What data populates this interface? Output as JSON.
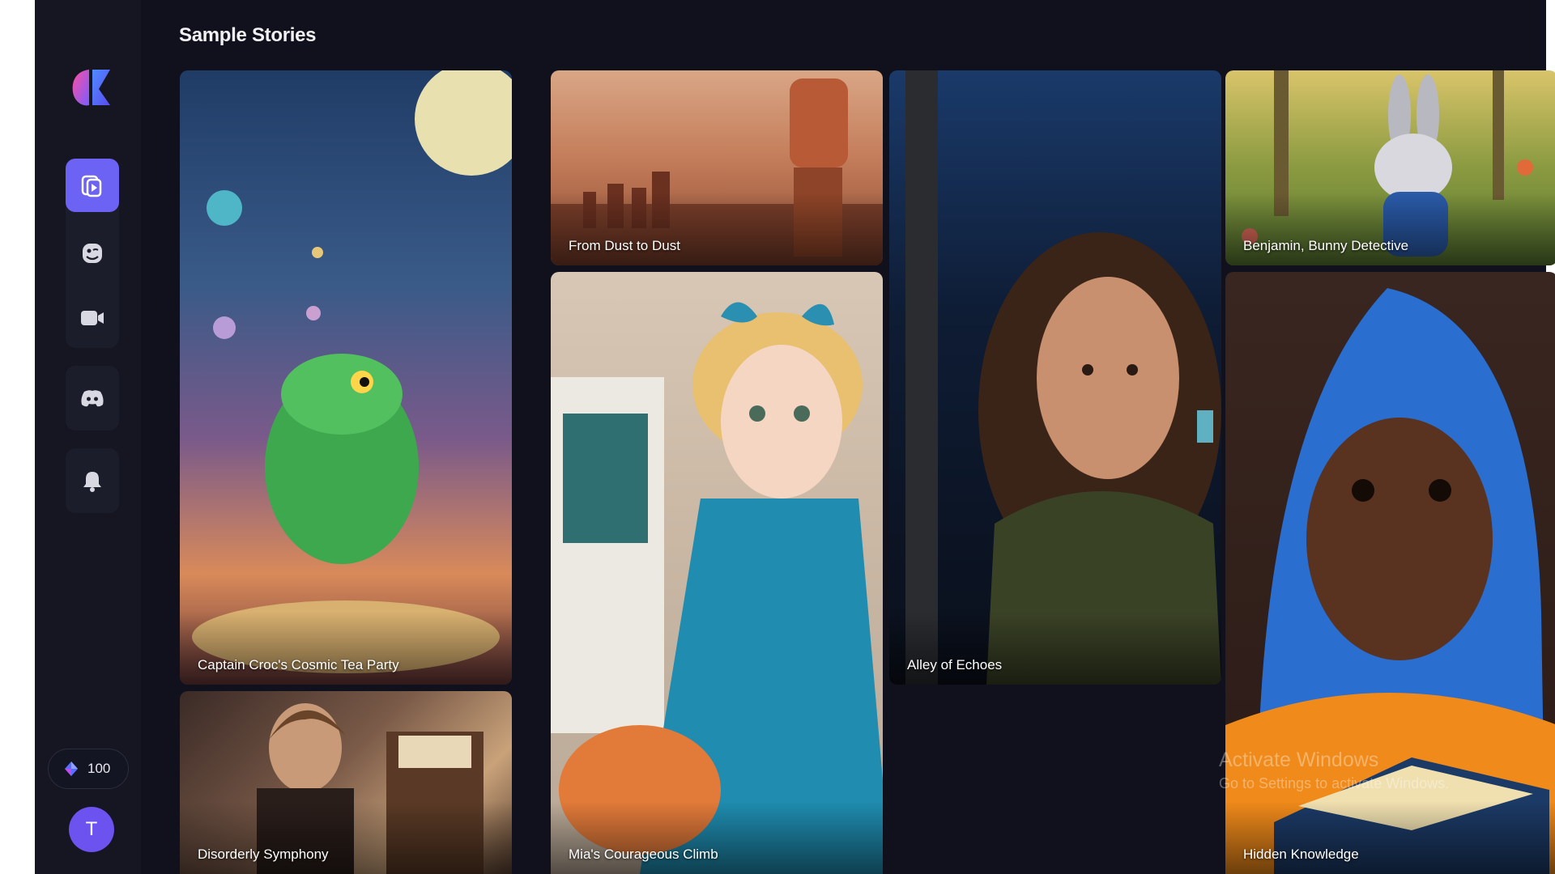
{
  "page": {
    "title": "Sample Stories"
  },
  "sidebar": {
    "nav": [
      {
        "icon": "stories-icon",
        "active": true
      },
      {
        "icon": "character-icon",
        "active": false
      },
      {
        "icon": "video-icon",
        "active": false
      }
    ],
    "discord_icon": "discord-icon",
    "notifications_icon": "bell-icon",
    "credits": {
      "icon": "diamond-icon",
      "value": "100"
    },
    "avatar_initial": "T"
  },
  "stories": [
    {
      "title": "Captain Croc's Cosmic Tea Party"
    },
    {
      "title": "Disorderly Symphony"
    },
    {
      "title": "From Dust to Dust"
    },
    {
      "title": "Mia's Courageous Climb"
    },
    {
      "title": "Alley of Echoes"
    },
    {
      "title": "Benjamin, Bunny Detective"
    },
    {
      "title": "Hidden Knowledge"
    }
  ],
  "watermark": {
    "line1": "Activate Windows",
    "line2": "Go to Settings to activate Windows."
  },
  "colors": {
    "app_bg": "#10111c",
    "sidebar_bg": "#151621",
    "accent": "#6c63f5"
  }
}
